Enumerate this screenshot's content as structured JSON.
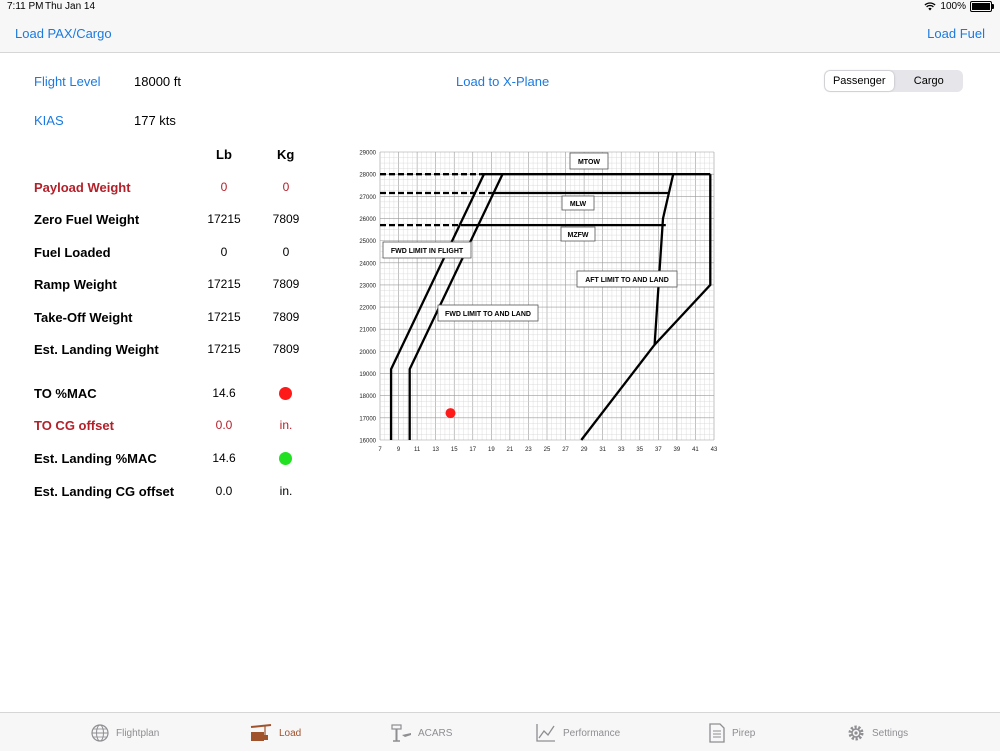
{
  "status": {
    "time": "7:11 PM",
    "date": "Thu Jan 14",
    "battery": "100%"
  },
  "nav": {
    "left": "Load PAX/Cargo",
    "right": "Load Fuel"
  },
  "flight": {
    "flight_level_label": "Flight Level",
    "flight_level_value": "18000 ft",
    "kias_label": "KIAS",
    "kias_value": "177 kts"
  },
  "load_xplane": "Load to X-Plane",
  "segment": {
    "options": [
      "Passenger",
      "Cargo"
    ],
    "selected": "Passenger"
  },
  "table": {
    "col_lb": "Lb",
    "col_kg": "Kg",
    "rows": [
      {
        "label": "Payload Weight",
        "lb": "0",
        "kg": "0"
      },
      {
        "label": "Zero Fuel Weight",
        "lb": "17215",
        "kg": "7809"
      },
      {
        "label": "Fuel Loaded",
        "lb": "0",
        "kg": "0"
      },
      {
        "label": "Ramp Weight",
        "lb": "17215",
        "kg": "7809"
      },
      {
        "label": "Take-Off Weight",
        "lb": "17215",
        "kg": "7809"
      },
      {
        "label": "Est. Landing Weight",
        "lb": "17215",
        "kg": "7809"
      }
    ],
    "cg_rows": [
      {
        "label": "TO %MAC",
        "value": "14.6",
        "status_color": "#ff1a1a"
      },
      {
        "label": "TO CG offset",
        "value": "0.0",
        "unit": "in."
      },
      {
        "label": "Est. Landing %MAC",
        "value": "14.6",
        "status_color": "#22e022"
      },
      {
        "label": "Est. Landing CG offset",
        "value": "0.0",
        "unit": "in."
      }
    ]
  },
  "chart_data": {
    "type": "scatter",
    "x_ticks": [
      "7",
      "9",
      "11",
      "13",
      "15",
      "17",
      "19",
      "21",
      "23",
      "25",
      "27",
      "29",
      "31",
      "33",
      "35",
      "37",
      "39",
      "41",
      "43"
    ],
    "y_ticks": [
      "16000",
      "17000",
      "18000",
      "19000",
      "20000",
      "21000",
      "22000",
      "23000",
      "24000",
      "25000",
      "26000",
      "27000",
      "28000",
      "29000"
    ],
    "xlim": [
      7,
      43
    ],
    "ylim": [
      16000,
      29000
    ],
    "grid": true,
    "limit_labels": [
      "MTOW",
      "MLW",
      "MZFW",
      "FWD LIMIT IN FLIGHT",
      "AFT LIMIT TO AND LAND",
      "FWD LIMIT TO AND LAND"
    ],
    "envelope_lines": [
      {
        "name": "fwd_in_flight",
        "points": [
          [
            8.2,
            16000
          ],
          [
            8.2,
            19200
          ],
          [
            18.2,
            28000
          ]
        ],
        "style": "solid"
      },
      {
        "name": "fwd_to_land",
        "points": [
          [
            10.2,
            16000
          ],
          [
            10.2,
            19200
          ],
          [
            20.2,
            28000
          ]
        ],
        "style": "solid"
      },
      {
        "name": "mtow",
        "points": [
          [
            7,
            28000
          ],
          [
            17.8,
            28000
          ]
        ],
        "style": "dashed"
      },
      {
        "name": "mtow_solid",
        "points": [
          [
            17.8,
            28000
          ],
          [
            42.6,
            28000
          ]
        ],
        "style": "solid"
      },
      {
        "name": "mlw",
        "points": [
          [
            7,
            27150
          ],
          [
            19,
            27150
          ]
        ],
        "style": "dashed"
      },
      {
        "name": "mlw_solid",
        "points": [
          [
            19,
            27150
          ],
          [
            38.2,
            27150
          ]
        ],
        "style": "solid"
      },
      {
        "name": "mzfw",
        "points": [
          [
            7,
            25700
          ],
          [
            16,
            25700
          ]
        ],
        "style": "dashed"
      },
      {
        "name": "mzfw_solid",
        "points": [
          [
            16,
            25700
          ],
          [
            37.8,
            25700
          ]
        ],
        "style": "solid"
      },
      {
        "name": "aft_to_land",
        "points": [
          [
            38.6,
            28000
          ],
          [
            37.5,
            26000
          ],
          [
            36.6,
            20300
          ]
        ],
        "style": "solid"
      },
      {
        "name": "aft_limit",
        "points": [
          [
            42.6,
            28000
          ],
          [
            42.6,
            23000
          ],
          [
            36.6,
            20300
          ],
          [
            28.7,
            16000
          ]
        ],
        "style": "solid"
      }
    ],
    "current_point": {
      "x": 14.6,
      "y": 17215,
      "color": "#ff1a1a"
    }
  },
  "tabs": [
    {
      "label": "Flightplan",
      "icon": "globe-icon",
      "active": false
    },
    {
      "label": "Load",
      "icon": "cargo-icon",
      "active": true
    },
    {
      "label": "ACARS",
      "icon": "tower-icon",
      "active": false
    },
    {
      "label": "Performance",
      "icon": "performance-icon",
      "active": false
    },
    {
      "label": "Pirep",
      "icon": "document-icon",
      "active": false
    },
    {
      "label": "Settings",
      "icon": "gear-icon",
      "active": false
    }
  ]
}
